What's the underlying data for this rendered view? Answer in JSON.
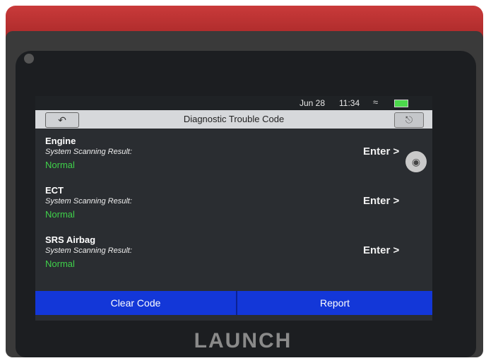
{
  "statusbar": {
    "date": "Jun 28",
    "time": "11:34",
    "wifi_icon": "wifi-icon",
    "battery_icon": "battery-icon",
    "battery_color": "#4cd94c"
  },
  "titlebar": {
    "back_icon": "back-arrow-icon",
    "title": "Diagnostic Trouble Code",
    "exit_icon": "exit-icon"
  },
  "systems": [
    {
      "name": "Engine",
      "result_label": "System Scanning Result:",
      "status": "Normal",
      "enter_label": "Enter >"
    },
    {
      "name": "ECT",
      "result_label": "System Scanning Result:",
      "status": "Normal",
      "enter_label": "Enter >"
    },
    {
      "name": "SRS Airbag",
      "result_label": "System Scanning Result:",
      "status": "Normal",
      "enter_label": "Enter >"
    }
  ],
  "camera_icon": "camera-icon",
  "bottom_bar": {
    "clear_code": "Clear Code",
    "report": "Report",
    "color": "#1337d8"
  },
  "status_color": "#3fd14a",
  "device": {
    "brand": "LAUNCH",
    "accent": "#c93a3a"
  }
}
